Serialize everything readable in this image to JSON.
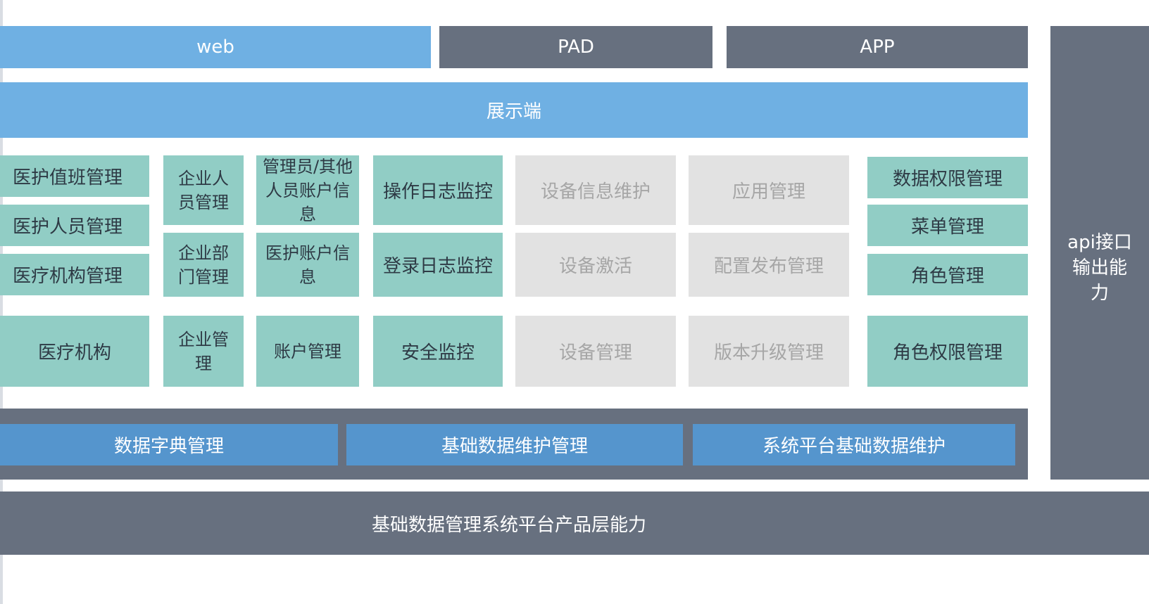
{
  "top": {
    "web": "web",
    "pad": "PAD",
    "app": "APP"
  },
  "display_layer": "展示端",
  "modules": {
    "c1": [
      "医护值班管理",
      "医护人员管理",
      "医疗机构管理",
      "医疗机构"
    ],
    "c2": [
      "企业人员管理",
      "企业部门管理",
      "企业管理"
    ],
    "c3": [
      "管理员/其他人员账户信息",
      "医护账户信息",
      "账户管理"
    ],
    "c4": [
      "操作日志监控",
      "登录日志监控",
      "安全监控"
    ],
    "c5": [
      "设备信息维护",
      "设备激活",
      "设备管理"
    ],
    "c6": [
      "应用管理",
      "配置发布管理",
      "版本升级管理"
    ],
    "c7": [
      "数据权限管理",
      "菜单管理",
      "角色管理",
      "角色权限管理"
    ]
  },
  "data_maintenance": [
    "数据字典管理",
    "基础数据维护管理",
    "系统平台基础数据维护"
  ],
  "api_output": "api接口输出能力",
  "platform_layer": "基础数据管理系统平台产品层能力",
  "colors": {
    "blue": "#6fb0e3",
    "slate": "#67707f",
    "teal": "#91cdc5",
    "gray": "#e2e2e2",
    "mid_blue": "#5595cd"
  }
}
